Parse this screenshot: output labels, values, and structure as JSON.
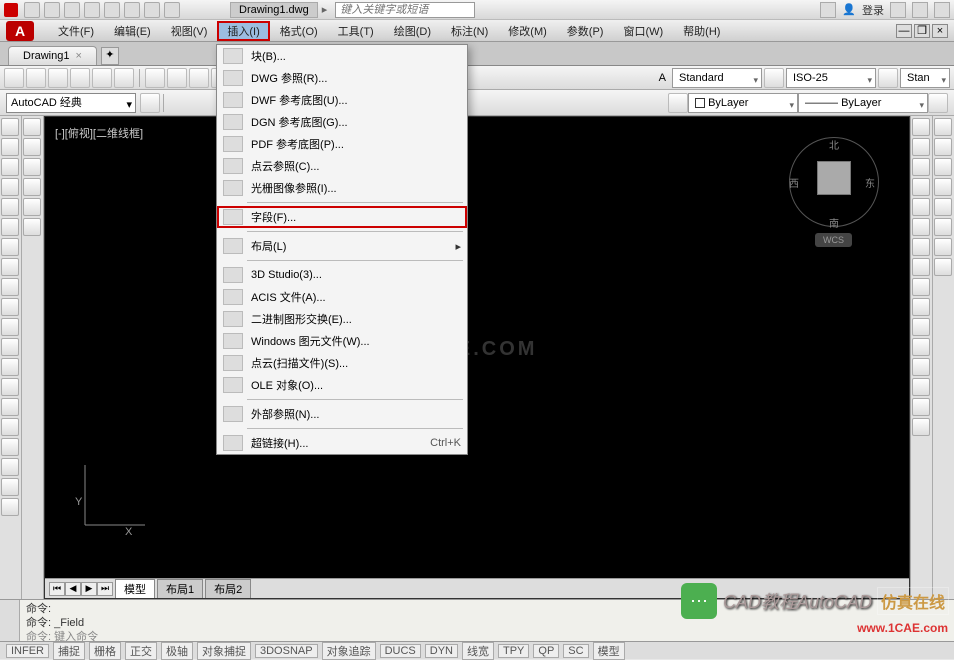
{
  "titlebar": {
    "filename": "Drawing1.dwg",
    "search_placeholder": "键入关键字或短语",
    "login": "登录"
  },
  "menubar": {
    "logo": "A",
    "items": [
      "文件(F)",
      "编辑(E)",
      "视图(V)",
      "插入(I)",
      "格式(O)",
      "工具(T)",
      "绘图(D)",
      "标注(N)",
      "修改(M)",
      "参数(P)",
      "窗口(W)",
      "帮助(H)"
    ],
    "active_index": 3
  },
  "doc_tab": {
    "label": "Drawing1",
    "close": "×"
  },
  "workspace": {
    "combo": "AutoCAD 经典"
  },
  "props_row": {
    "textstyle": "Standard",
    "dimstyle": "ISO-25",
    "tablestyle": "Stan",
    "color": "ByLayer",
    "lineweight": "ByLayer"
  },
  "dropdown": {
    "items": [
      {
        "label": "块(B)...",
        "type": "item"
      },
      {
        "label": "DWG 参照(R)...",
        "type": "item"
      },
      {
        "label": "DWF 参考底图(U)...",
        "type": "item"
      },
      {
        "label": "DGN 参考底图(G)...",
        "type": "item"
      },
      {
        "label": "PDF 参考底图(P)...",
        "type": "item"
      },
      {
        "label": "点云参照(C)...",
        "type": "item"
      },
      {
        "label": "光栅图像参照(I)...",
        "type": "item"
      },
      {
        "type": "sep"
      },
      {
        "label": "字段(F)...",
        "type": "item",
        "highlighted": true
      },
      {
        "type": "sep"
      },
      {
        "label": "布局(L)",
        "type": "submenu"
      },
      {
        "type": "sep"
      },
      {
        "label": "3D Studio(3)...",
        "type": "item"
      },
      {
        "label": "ACIS 文件(A)...",
        "type": "item"
      },
      {
        "label": "二进制图形交换(E)...",
        "type": "item"
      },
      {
        "label": "Windows 图元文件(W)...",
        "type": "item"
      },
      {
        "label": "点云(扫描文件)(S)...",
        "type": "item"
      },
      {
        "label": "OLE 对象(O)...",
        "type": "item"
      },
      {
        "type": "sep"
      },
      {
        "label": "外部参照(N)...",
        "type": "item"
      },
      {
        "type": "sep"
      },
      {
        "label": "超链接(H)...",
        "type": "item",
        "shortcut": "Ctrl+K"
      }
    ]
  },
  "drawing": {
    "viewport_label": "[-][俯视][二维线框]",
    "watermark": "1CAE.COM",
    "compass": {
      "n": "北",
      "s": "南",
      "e": "东",
      "w": "西"
    },
    "wcs": "WCS",
    "ucs_y": "Y",
    "ucs_x": "X"
  },
  "model_tabs": {
    "tabs": [
      "模型",
      "布局1",
      "布局2"
    ],
    "active": 0
  },
  "cmdline": {
    "line1": "命令:",
    "line2": "命令: _Field",
    "prompt": "命令: 键入命令"
  },
  "statusbar": {
    "buttons": [
      "INFER",
      "捕捉",
      "栅格",
      "正交",
      "极轴",
      "对象捕捉",
      "3DOSNAP",
      "对象追踪",
      "DUCS",
      "DYN",
      "线宽",
      "TPY",
      "QP",
      "SC",
      "模型"
    ]
  },
  "overlay": {
    "text1": "CAD教程AutoCAD",
    "text2": "仿真在线",
    "text3": "www.1CAE.com"
  }
}
